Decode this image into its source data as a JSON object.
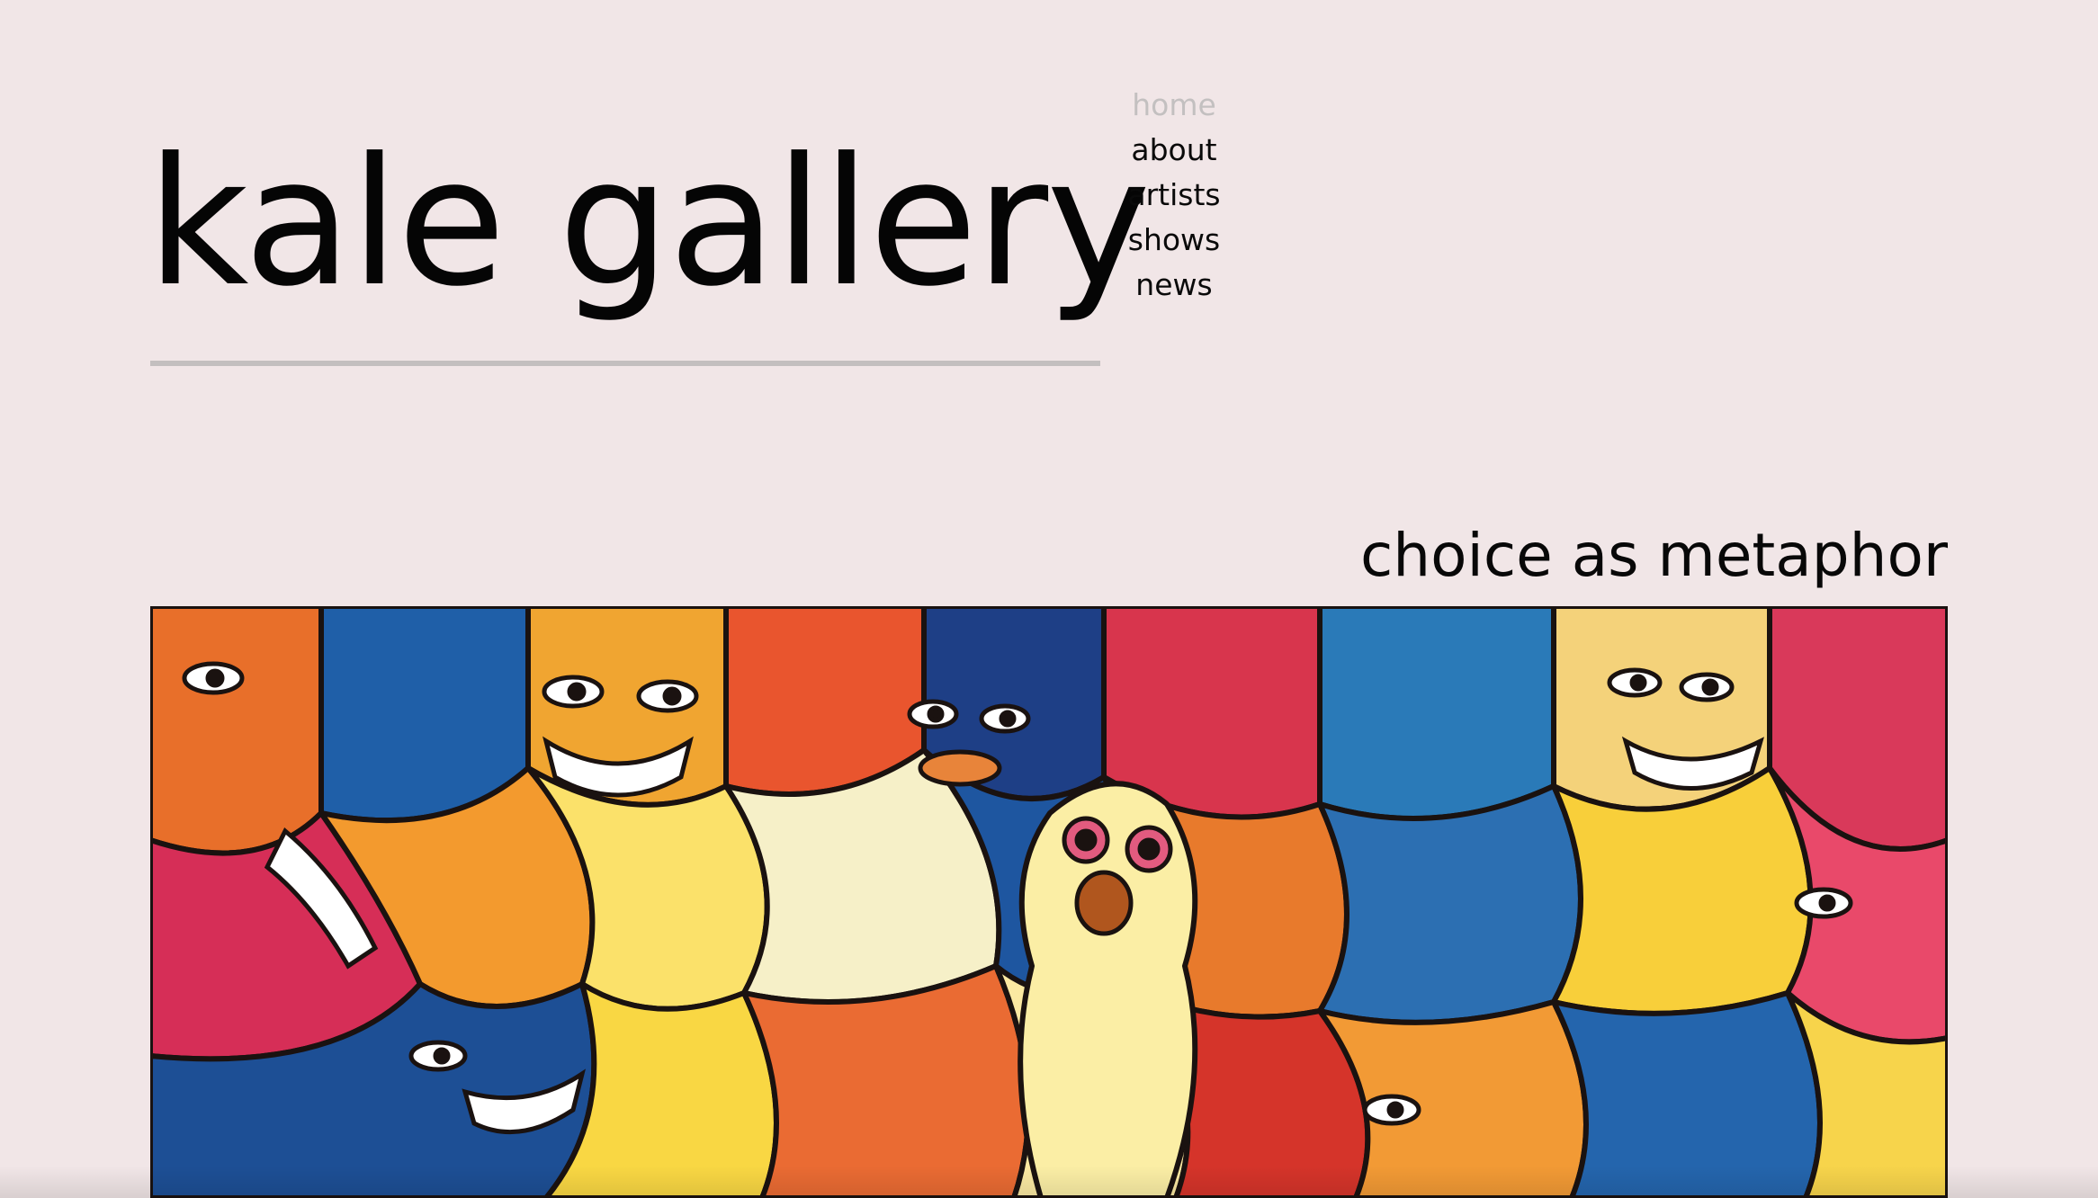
{
  "site": {
    "title": "kale gallery"
  },
  "nav": {
    "items": [
      {
        "label": "home",
        "active": true
      },
      {
        "label": "about",
        "active": false
      },
      {
        "label": "artists",
        "active": false
      },
      {
        "label": "shows",
        "active": false
      },
      {
        "label": "news",
        "active": false
      }
    ]
  },
  "show": {
    "title": "choice as metaphor"
  },
  "colors": {
    "background": "#f1e6e7",
    "text": "#0a0a0a",
    "nav_active": "#c3c0c0",
    "rule": "#c3bfbf"
  }
}
